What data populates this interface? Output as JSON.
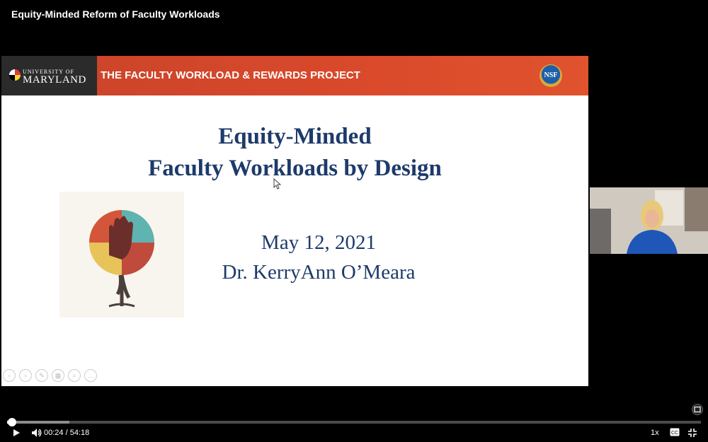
{
  "video_title": "Equity-Minded Reform of Faculty Workloads",
  "slide": {
    "logo_top": "UNIVERSITY OF",
    "logo_main": "MARYLAND",
    "banner_title": "THE FACULTY WORKLOAD & REWARDS PROJECT",
    "nsf_label": "NSF",
    "headline_line1": "Equity-Minded",
    "headline_line2": "Faculty Workloads by Design",
    "date": "May 12, 2021",
    "presenter": "Dr. KerryAnn O’Meara",
    "colors": {
      "banner": "#d9492b",
      "heading": "#1d3a6b"
    }
  },
  "player": {
    "current_time": "00:24",
    "separator": "/",
    "duration": "54:18",
    "speed": "1x",
    "progress_played": 0.007,
    "progress_buffered": 0.09,
    "icons": [
      "play-icon",
      "volume-icon",
      "captions-icon",
      "exit-fullscreen-icon",
      "picture-in-picture-icon"
    ]
  }
}
